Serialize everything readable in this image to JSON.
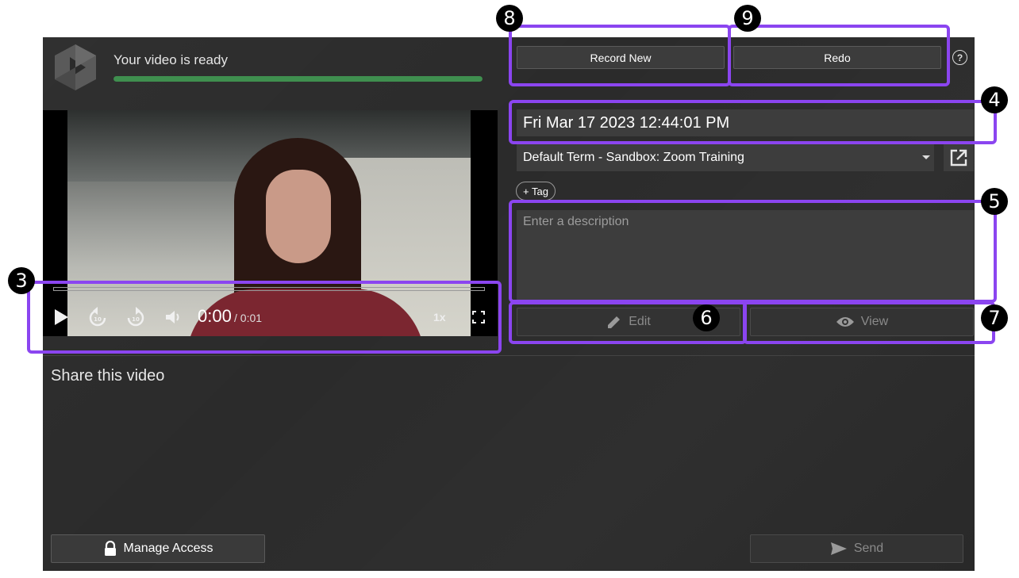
{
  "header": {
    "status_text": "Your video is ready",
    "progress_fraction": 1.0
  },
  "player": {
    "current_time": "0:00",
    "total_time": "/ 0:01",
    "speed": "1x",
    "icons": [
      "play-icon",
      "rewind-10-icon",
      "forward-10-icon",
      "volume-icon",
      "fullscreen-icon"
    ]
  },
  "actions": {
    "record_new": "Record New",
    "redo": "Redo",
    "help": "?"
  },
  "form": {
    "title_value": "Fri Mar 17 2023 12:44:01 PM",
    "folder_value": "Default Term - Sandbox: Zoom Training",
    "tag_label": "+ Tag",
    "description_placeholder": "Enter a description",
    "edit_label": "Edit",
    "view_label": "View"
  },
  "share": {
    "title": "Share this video",
    "manage_access_label": "Manage Access",
    "send_label": "Send"
  },
  "annotations": {
    "markers": [
      "3",
      "4",
      "5",
      "6",
      "7",
      "8",
      "9"
    ],
    "highlight_color": "#8b45f0"
  }
}
